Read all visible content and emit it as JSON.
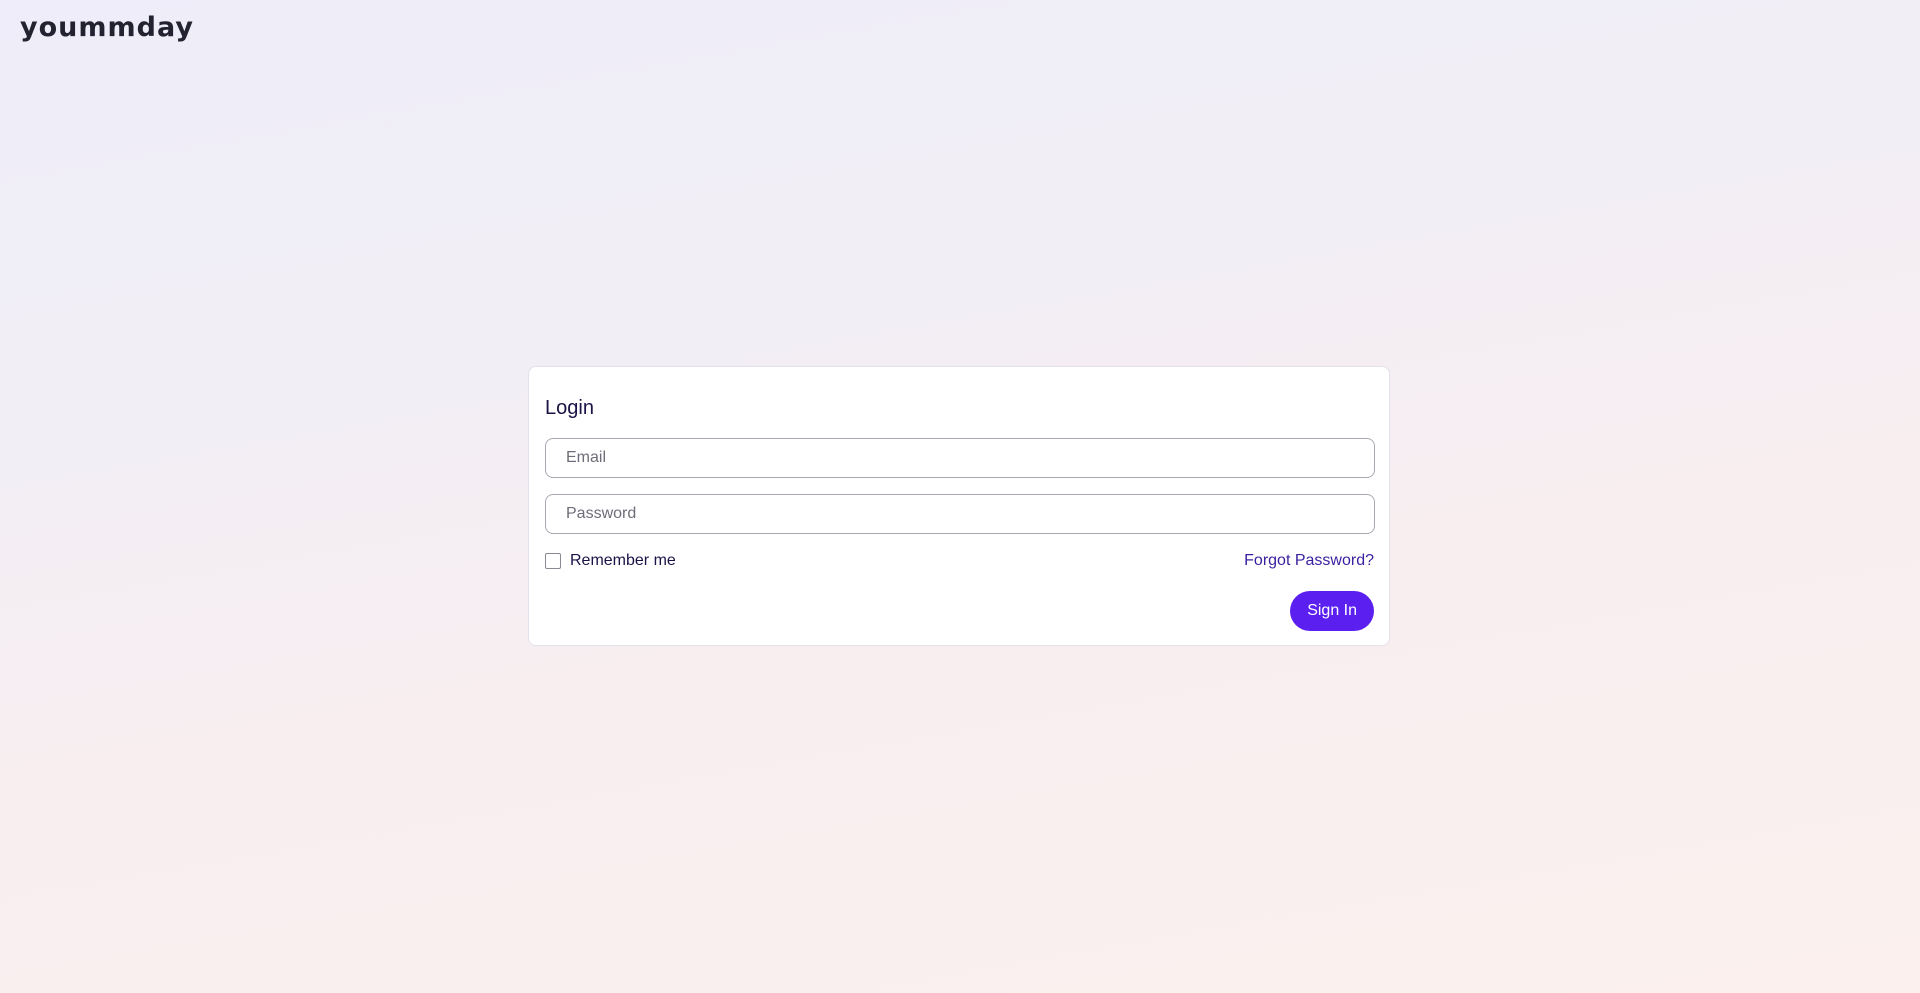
{
  "brand": {
    "name": "yoummday"
  },
  "login": {
    "title": "Login",
    "email_placeholder": "Email",
    "email_value": "",
    "password_placeholder": "Password",
    "password_value": "",
    "remember_label": "Remember me",
    "remember_checked": false,
    "forgot_label": "Forgot Password?",
    "signin_label": "Sign In"
  },
  "colors": {
    "accent": "#5b1ff0",
    "link": "#3a1fa0",
    "heading": "#1a1446"
  },
  "icons": {
    "checkbox": "checkbox-unchecked-icon"
  }
}
